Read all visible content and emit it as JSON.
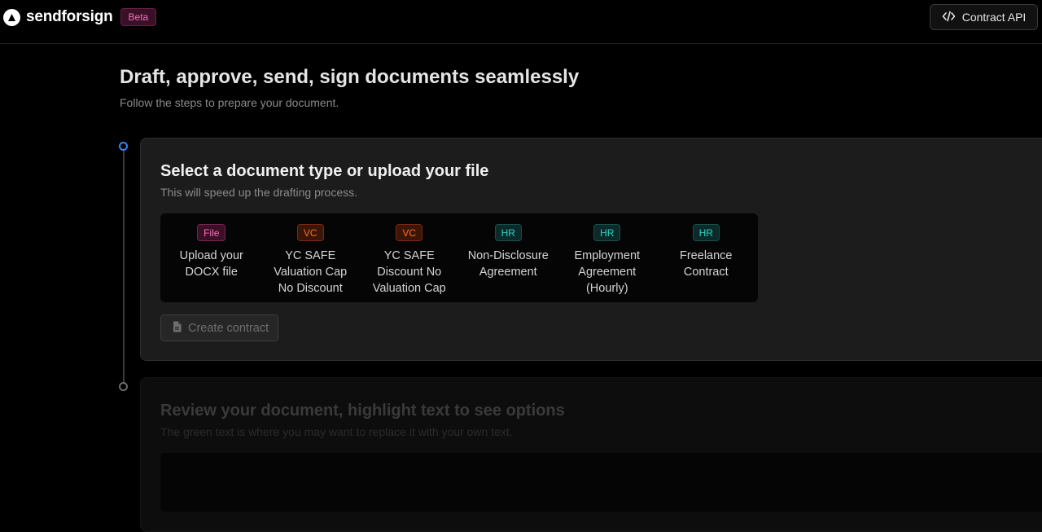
{
  "header": {
    "brand": "sendforsign",
    "badge": "Beta",
    "api_button_label": "Contract API"
  },
  "main": {
    "title": "Draft, approve, send, sign documents seamlessly",
    "subtitle": "Follow the steps to prepare your document."
  },
  "step1": {
    "title": "Select a document type or upload your file",
    "subtitle": "This will speed up the drafting process.",
    "documents": [
      {
        "tag": "File",
        "label": "Upload your DOCX file"
      },
      {
        "tag": "VC",
        "label": "YC SAFE Valuation Cap No Discount"
      },
      {
        "tag": "VC",
        "label": "YC SAFE Discount No Valuation Cap"
      },
      {
        "tag": "HR",
        "label": "Non-Disclosure Agreement"
      },
      {
        "tag": "HR",
        "label": "Employment Agreement (Hourly)"
      },
      {
        "tag": "HR",
        "label": "Freelance Contract"
      }
    ],
    "create_button_label": "Create contract"
  },
  "step2": {
    "title": "Review your document, highlight text to see options",
    "subtitle": "The green text is where you may want to replace it with your own text."
  },
  "colors": {
    "accent": "#3b82f6",
    "tag_file": "#f472b6",
    "tag_vc": "#f97316",
    "tag_hr": "#2dd4bf"
  }
}
